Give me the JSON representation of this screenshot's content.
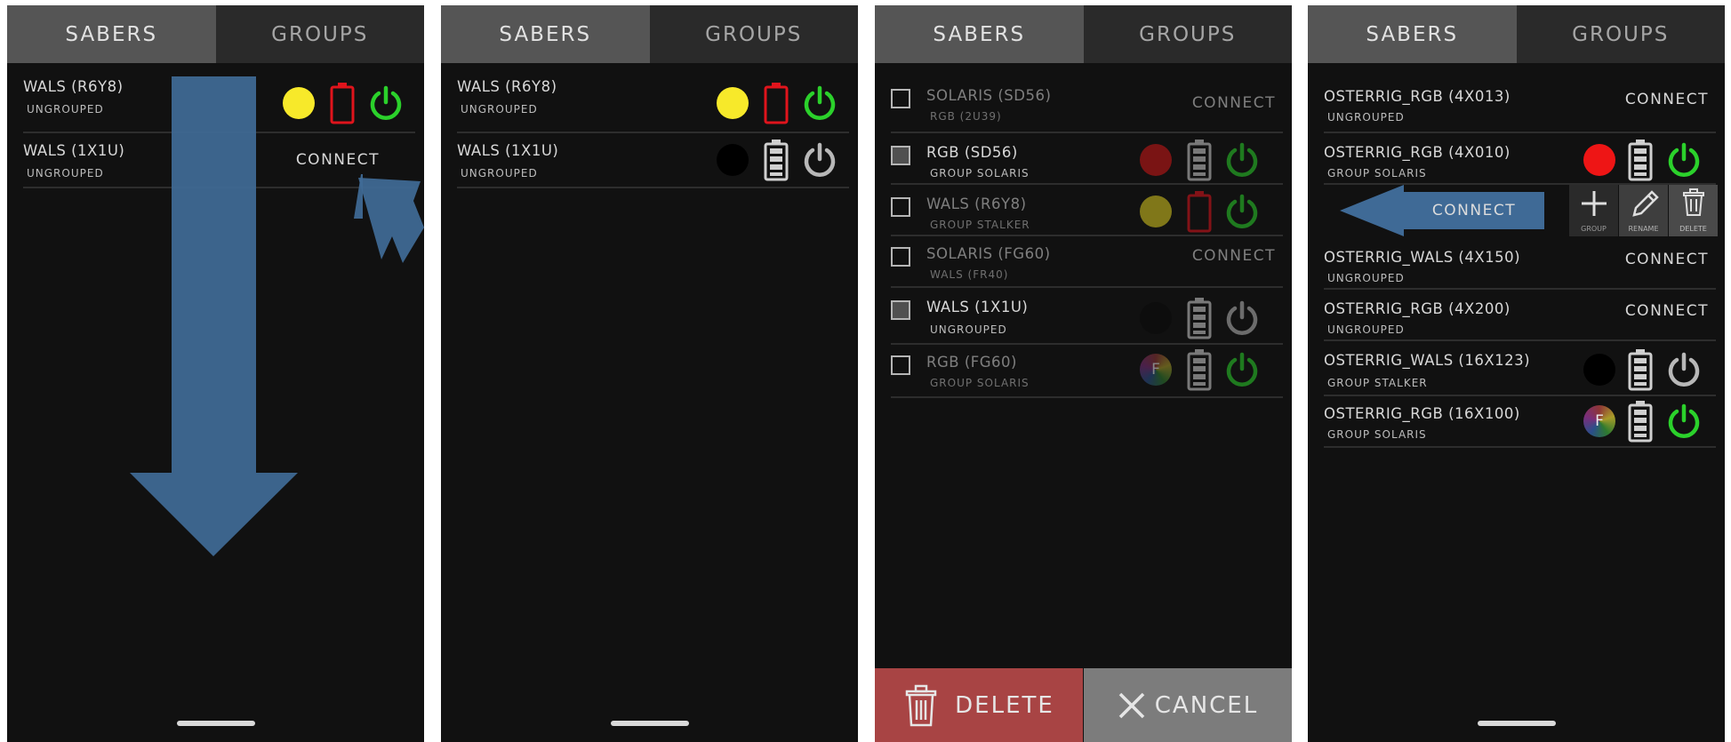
{
  "tabs": {
    "sabers": "SABERS",
    "groups": "GROUPS"
  },
  "screen1": {
    "rows": [
      {
        "name": "WALS (R6Y8)",
        "group": "UNGROUPED"
      },
      {
        "name": "WALS (1X1U)",
        "group": "UNGROUPED",
        "action": "CONNECT"
      }
    ]
  },
  "screen2": {
    "rows": [
      {
        "name": "WALS (R6Y8)",
        "group": "UNGROUPED"
      },
      {
        "name": "WALS (1X1U)",
        "group": "UNGROUPED"
      }
    ]
  },
  "screen3": {
    "rows": [
      {
        "name": "SOLARIS (SD56)",
        "group": "RGB (2U39)",
        "action": "CONNECT"
      },
      {
        "name": "RGB (SD56)",
        "group": "GROUP SOLARIS"
      },
      {
        "name": "WALS (R6Y8)",
        "group": "GROUP STALKER"
      },
      {
        "name": "SOLARIS (FG60)",
        "group": "WALS (FR40)",
        "action": "CONNECT"
      },
      {
        "name": "WALS (1X1U)",
        "group": "UNGROUPED"
      },
      {
        "name": "RGB (FG60)",
        "group": "GROUP SOLARIS",
        "badge": "F"
      }
    ],
    "delete_label": "DELETE",
    "cancel_label": "CANCEL"
  },
  "screen4": {
    "rows": [
      {
        "name": "OSTERRIG_RGB (4X013)",
        "group": "UNGROUPED",
        "action": "CONNECT"
      },
      {
        "name": "OSTERRIG_RGB (4X010)",
        "group": "GROUP SOLARIS"
      },
      {
        "name": "OSTERRIG_WALS (4X150)",
        "group": "UNGROUPED",
        "action": "CONNECT"
      },
      {
        "name": "OSTERRIG_RGB (4X200)",
        "group": "UNGROUPED",
        "action": "CONNECT"
      },
      {
        "name": "OSTERRIG_WALS (16X123)",
        "group": "GROUP STALKER"
      },
      {
        "name": "OSTERRIG_RGB (16X100)",
        "group": "GROUP SOLARIS",
        "badge": "F"
      }
    ],
    "swipe_connect": "CONNECT",
    "swipe_actions": {
      "group": "GROUP",
      "rename": "RENAME",
      "delete": "DELETE"
    }
  },
  "colors": {
    "yellow": "#f7e92a",
    "red": "#e0141c",
    "green": "#2bd12b",
    "grey_icon": "#bdbdbd",
    "arrow": "#3f6a96",
    "delete_bg": "#a84444",
    "cancel_bg": "#7c7c7c"
  },
  "icons": [
    "color-dot",
    "battery-icon",
    "power-icon",
    "trash-icon",
    "close-icon",
    "plus-icon",
    "pencil-icon"
  ]
}
